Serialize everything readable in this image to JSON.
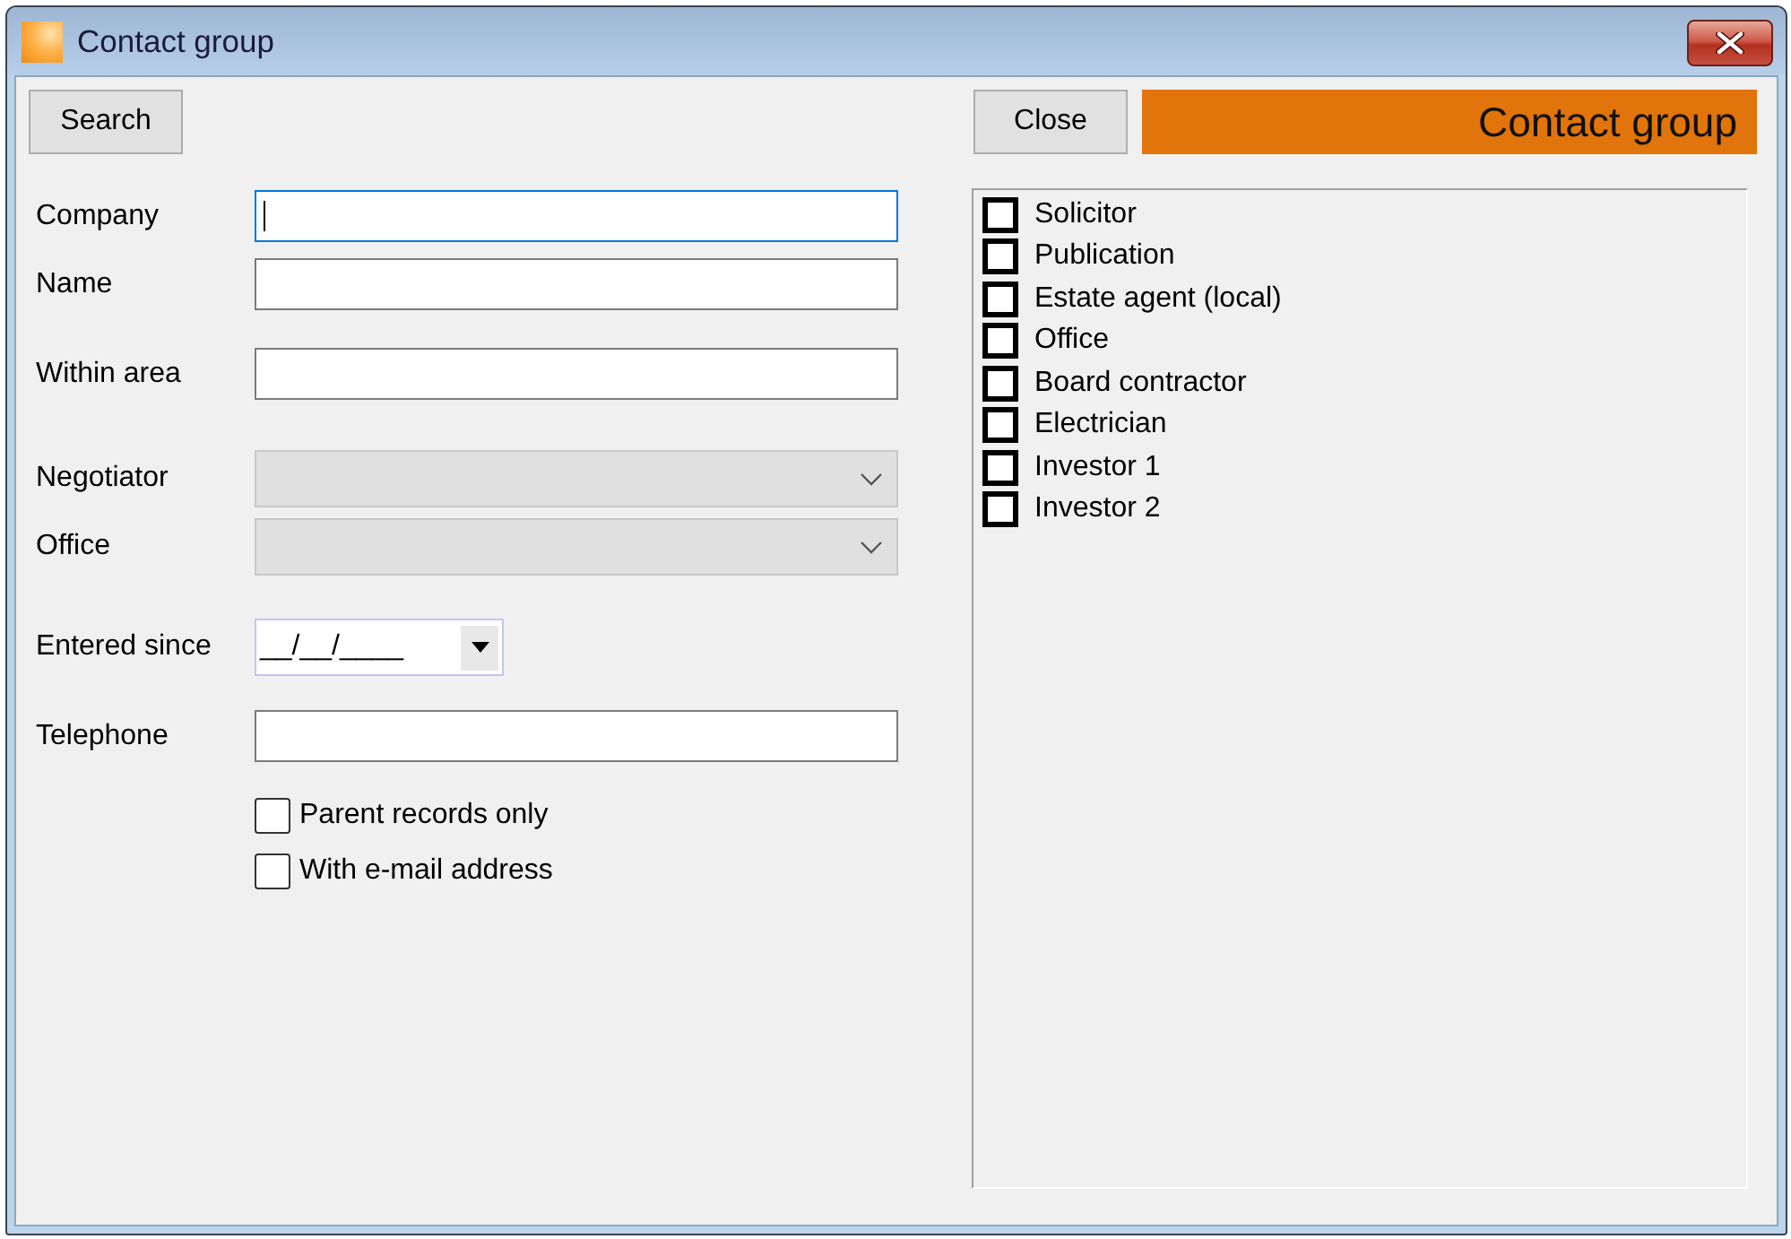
{
  "window": {
    "title": "Contact group"
  },
  "toolbar": {
    "search_button": "Search",
    "close_button": "Close",
    "banner": "Contact group"
  },
  "form": {
    "fields": [
      {
        "label": "Company",
        "kind": "text",
        "focused": true,
        "disabled": false
      },
      {
        "label": "Name",
        "kind": "text",
        "focused": false,
        "disabled": false
      },
      {
        "label": "Within area",
        "kind": "text",
        "focused": false,
        "disabled": false
      },
      {
        "label": "Negotiator",
        "kind": "combo",
        "focused": false,
        "disabled": true
      },
      {
        "label": "Office",
        "kind": "combo",
        "focused": false,
        "disabled": true
      },
      {
        "label": "Entered since",
        "kind": "date",
        "value": "__/__/____",
        "focused": false,
        "disabled": false
      },
      {
        "label": "Telephone",
        "kind": "text",
        "focused": false,
        "disabled": false
      }
    ],
    "options": [
      {
        "label": "Parent records only",
        "checked": false
      },
      {
        "label": "With e-mail address",
        "checked": false
      }
    ]
  },
  "contact_groups": {
    "items": [
      {
        "label": "Solicitor",
        "checked": false
      },
      {
        "label": "Publication",
        "checked": false
      },
      {
        "label": "Estate agent (local)",
        "checked": false
      },
      {
        "label": "Office",
        "checked": false
      },
      {
        "label": "Board contractor",
        "checked": false
      },
      {
        "label": "Electrician",
        "checked": false
      },
      {
        "label": "Investor 1",
        "checked": false
      },
      {
        "label": "Investor 2",
        "checked": false
      }
    ]
  }
}
